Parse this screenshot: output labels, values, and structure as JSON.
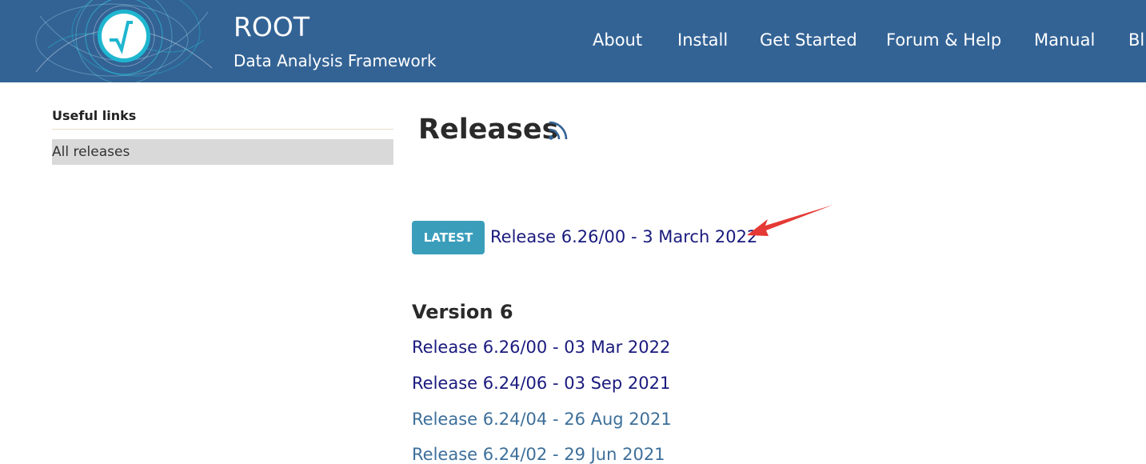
{
  "header": {
    "title": "ROOT",
    "subtitle": "Data Analysis Framework",
    "nav": [
      "About",
      "Install",
      "Get Started",
      "Forum & Help",
      "Manual",
      "Bl"
    ]
  },
  "sidebar": {
    "title": "Useful links",
    "items": [
      "All releases"
    ]
  },
  "main": {
    "title": "Releases",
    "latest_badge": "LATEST",
    "latest_link": "Release 6.26/00 - 3 March 2022",
    "section_title": "Version 6",
    "releases": [
      "Release 6.26/00 - 03 Mar 2022",
      "Release 6.24/06 - 03 Sep 2021",
      "Release 6.24/04 - 26 Aug 2021",
      "Release 6.24/02 - 29 Jun 2021"
    ]
  },
  "colors": {
    "header_bg": "#336395",
    "badge_bg": "#3a9ebb",
    "link": "#1a1a7e",
    "visited_link": "#3d6f9a",
    "annotation_arrow": "#e53935"
  }
}
